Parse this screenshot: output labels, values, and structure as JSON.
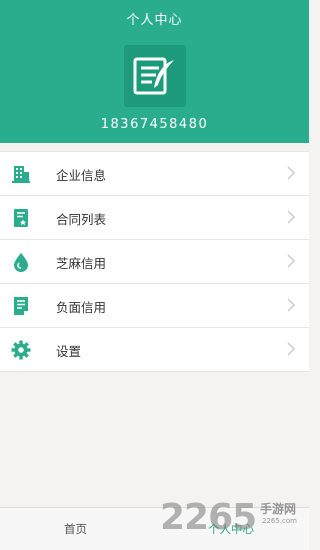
{
  "header": {
    "title": "个人中心",
    "phone": "18367458480"
  },
  "menu": {
    "items": [
      {
        "label": "企业信息",
        "icon": "building-icon"
      },
      {
        "label": "合同列表",
        "icon": "contract-icon"
      },
      {
        "label": "芝麻信用",
        "icon": "drop-icon"
      },
      {
        "label": "负面信用",
        "icon": "document-icon"
      },
      {
        "label": "设置",
        "icon": "gear-icon"
      }
    ]
  },
  "tabbar": {
    "home": "首页",
    "me": "个人中心"
  },
  "watermark": {
    "logo": "2265",
    "site": "手游网",
    "url": "2265.com"
  },
  "colors": {
    "accent": "#2aad8c",
    "avatar_bg": "#1d9a7c",
    "background": "#f4f3f1"
  }
}
